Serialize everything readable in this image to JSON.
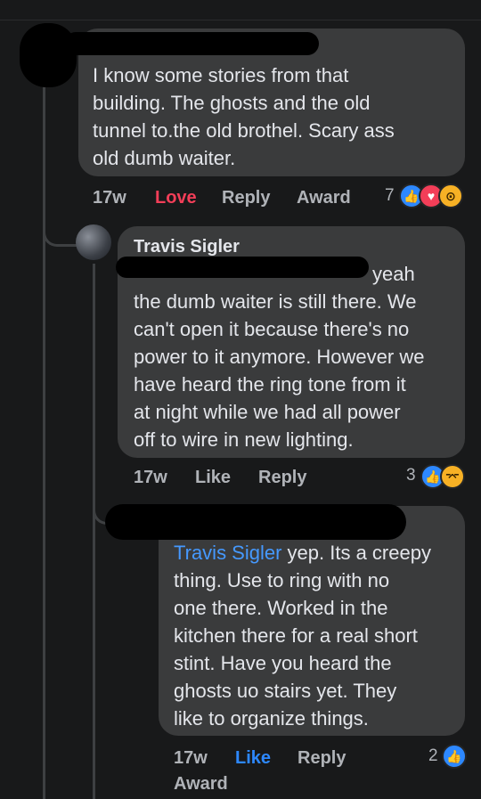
{
  "comment1": {
    "text_lines": [
      "I know some stories from that",
      "building. The ghosts and the old",
      "tunnel to.the old brothel. Scary ass",
      "old dumb waiter."
    ],
    "actions": {
      "time": "17w",
      "love": "Love",
      "reply": "Reply",
      "award": "Award"
    },
    "reaction_count": "7",
    "reactions": [
      "like-icon",
      "love-icon",
      "wow-icon"
    ]
  },
  "comment2": {
    "author": "Travis Sigler",
    "first_line_tail": "yeah",
    "text_lines": [
      "the dumb waiter is still there. We",
      "can't open it because there's no",
      "power to it anymore. However we",
      "have heard the ring tone from it",
      "at night while we had all power",
      "off to wire in new  lighting."
    ],
    "actions": {
      "time": "17w",
      "like": "Like",
      "reply": "Reply"
    },
    "reaction_count": "3",
    "reactions": [
      "like-icon",
      "haha-icon"
    ]
  },
  "comment3": {
    "mention": "Travis Sigler",
    "first_line_rest": " yep. Its a creepy",
    "text_lines": [
      "thing. Use to ring with no",
      "one there. Worked in the",
      "kitchen there for a real short",
      "stint. Have you heard the",
      "ghosts uo stairs yet. They",
      "like to organize things."
    ],
    "actions": {
      "time": "17w",
      "like": "Like",
      "reply": "Reply",
      "award": "Award"
    },
    "reaction_count": "2",
    "reactions": [
      "like-icon"
    ]
  },
  "colors": {
    "background": "#18191a",
    "bubble": "#3a3b3c",
    "link": "#4599ff",
    "love": "#f33e58",
    "like": "#2d88ff"
  }
}
